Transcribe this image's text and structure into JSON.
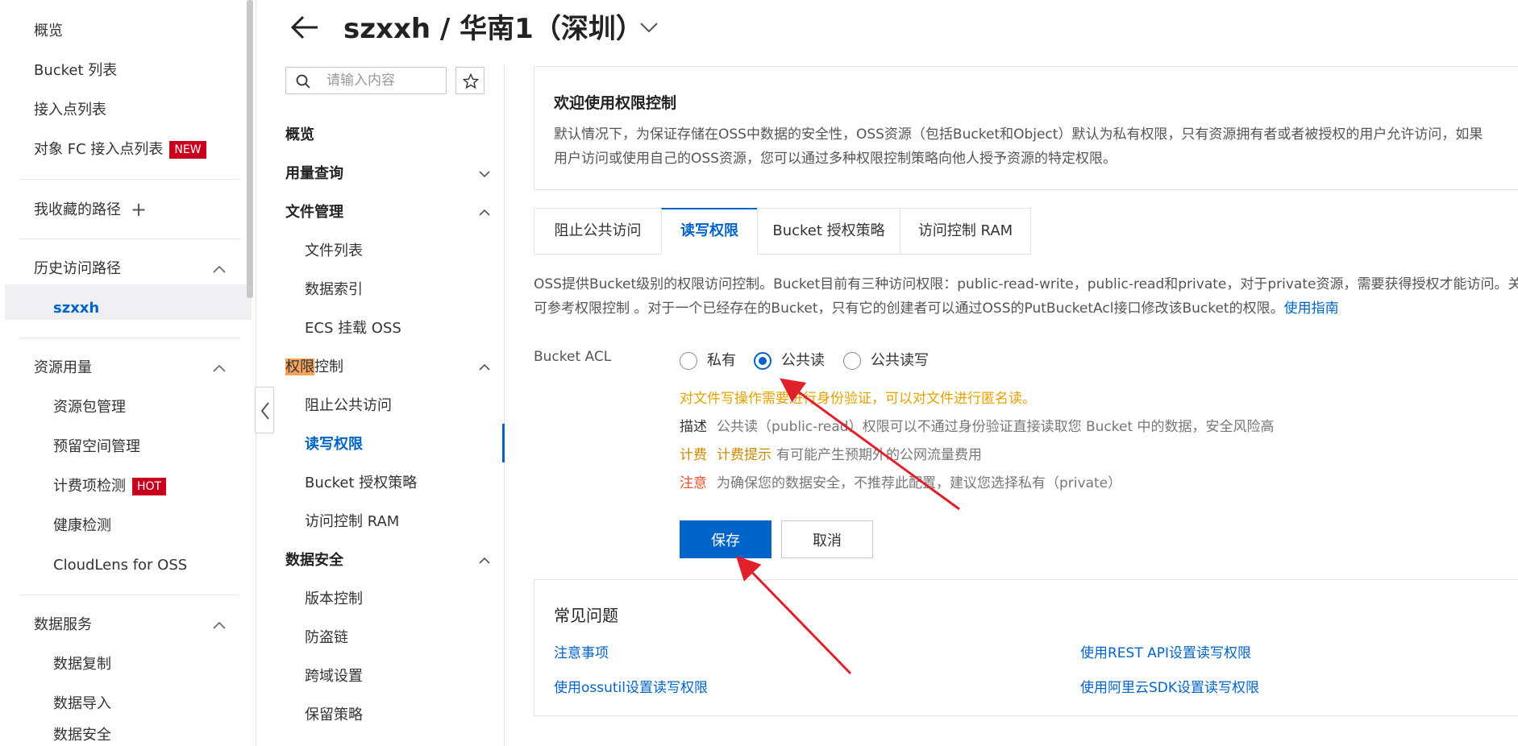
{
  "sidebar": {
    "items": [
      {
        "label": "概览"
      },
      {
        "label": "Bucket 列表"
      },
      {
        "label": "接入点列表"
      },
      {
        "label": "对象 FC 接入点列表",
        "badge": "NEW"
      }
    ],
    "favorites_label": "我收藏的路径",
    "history_label": "历史访问路径",
    "history_item": "szxxh",
    "resource_label": "资源用量",
    "resource_items": [
      {
        "label": "资源包管理"
      },
      {
        "label": "预留空间管理"
      },
      {
        "label": "计费项检测",
        "badge": "HOT"
      },
      {
        "label": "健康检测"
      },
      {
        "label": "CloudLens for OSS"
      }
    ],
    "data_service_label": "数据服务",
    "data_service_items": [
      {
        "label": "数据复制"
      },
      {
        "label": "数据导入"
      },
      {
        "label": "数据安全"
      }
    ]
  },
  "header": {
    "title": "szxxh / 华南1（深圳）"
  },
  "subnav": {
    "search_placeholder": "请输入内容",
    "overview": "概览",
    "usage": "用量查询",
    "file_mgmt": "文件管理",
    "file_items": [
      "文件列表",
      "数据索引",
      "ECS 挂载 OSS"
    ],
    "perm_highlight": "权限",
    "perm_rest": "控制",
    "perm_items": [
      "阻止公共访问",
      "读写权限",
      "Bucket 授权策略",
      "访问控制 RAM"
    ],
    "data_security": "数据安全",
    "security_items": [
      "版本控制",
      "防盗链",
      "跨域设置",
      "保留策略"
    ]
  },
  "welcome": {
    "title": "欢迎使用权限控制",
    "line1": "默认情况下，为保证存储在OSS中数据的安全性，OSS资源（包括Bucket和Object）默认为私有权限，只有资源拥有者或者被授权的用户允许访问，如果",
    "line2": "用户访问或使用自己的OSS资源，您可以通过多种权限控制策略向他人授予资源的特定权限。"
  },
  "tabs": [
    {
      "label": "阻止公共访问"
    },
    {
      "label": "读写权限",
      "active": true
    },
    {
      "label": "Bucket 授权策略"
    },
    {
      "label": "访问控制 RAM"
    }
  ],
  "description": {
    "line1": "OSS提供Bucket级别的权限访问控制。Bucket目前有三种访问权限：public-read-write，public-read和private，对于private资源，需要获得授权才能访问。关",
    "line2": "可参考权限控制 。对于一个已经存在的Bucket，只有它的创建者可以通过OSS的PutBucketAcl接口修改该Bucket的权限。",
    "guide_link": "使用指南"
  },
  "acl": {
    "label": "Bucket ACL",
    "options": [
      {
        "label": "私有",
        "checked": false
      },
      {
        "label": "公共读",
        "checked": true
      },
      {
        "label": "公共读写",
        "checked": false
      }
    ],
    "note": "对文件写操作需要进行身份验证，可以对文件进行匿名读。",
    "desc_key": "描述",
    "desc_value": "公共读（public-read）权限可以不通过身份验证直接读取您 Bucket 中的数据，安全风险高",
    "bill_key": "计费",
    "bill_hint": "计费提示",
    "bill_value": "有可能产生预期外的公网流量费用",
    "warn_key": "注意",
    "warn_value": "为确保您的数据安全，不推荐此配置，建议您选择私有（private）"
  },
  "buttons": {
    "save": "保存",
    "cancel": "取消"
  },
  "faq": {
    "title": "常见问题",
    "links": [
      "注意事项",
      "使用REST API设置读写权限",
      "使用ossutil设置读写权限",
      "使用阿里云SDK设置读写权限"
    ]
  },
  "colors": {
    "accent": "#0064c8",
    "badge": "#c8001e",
    "warning_text": "#e5a100",
    "annotation_arrow": "#e0202a"
  }
}
